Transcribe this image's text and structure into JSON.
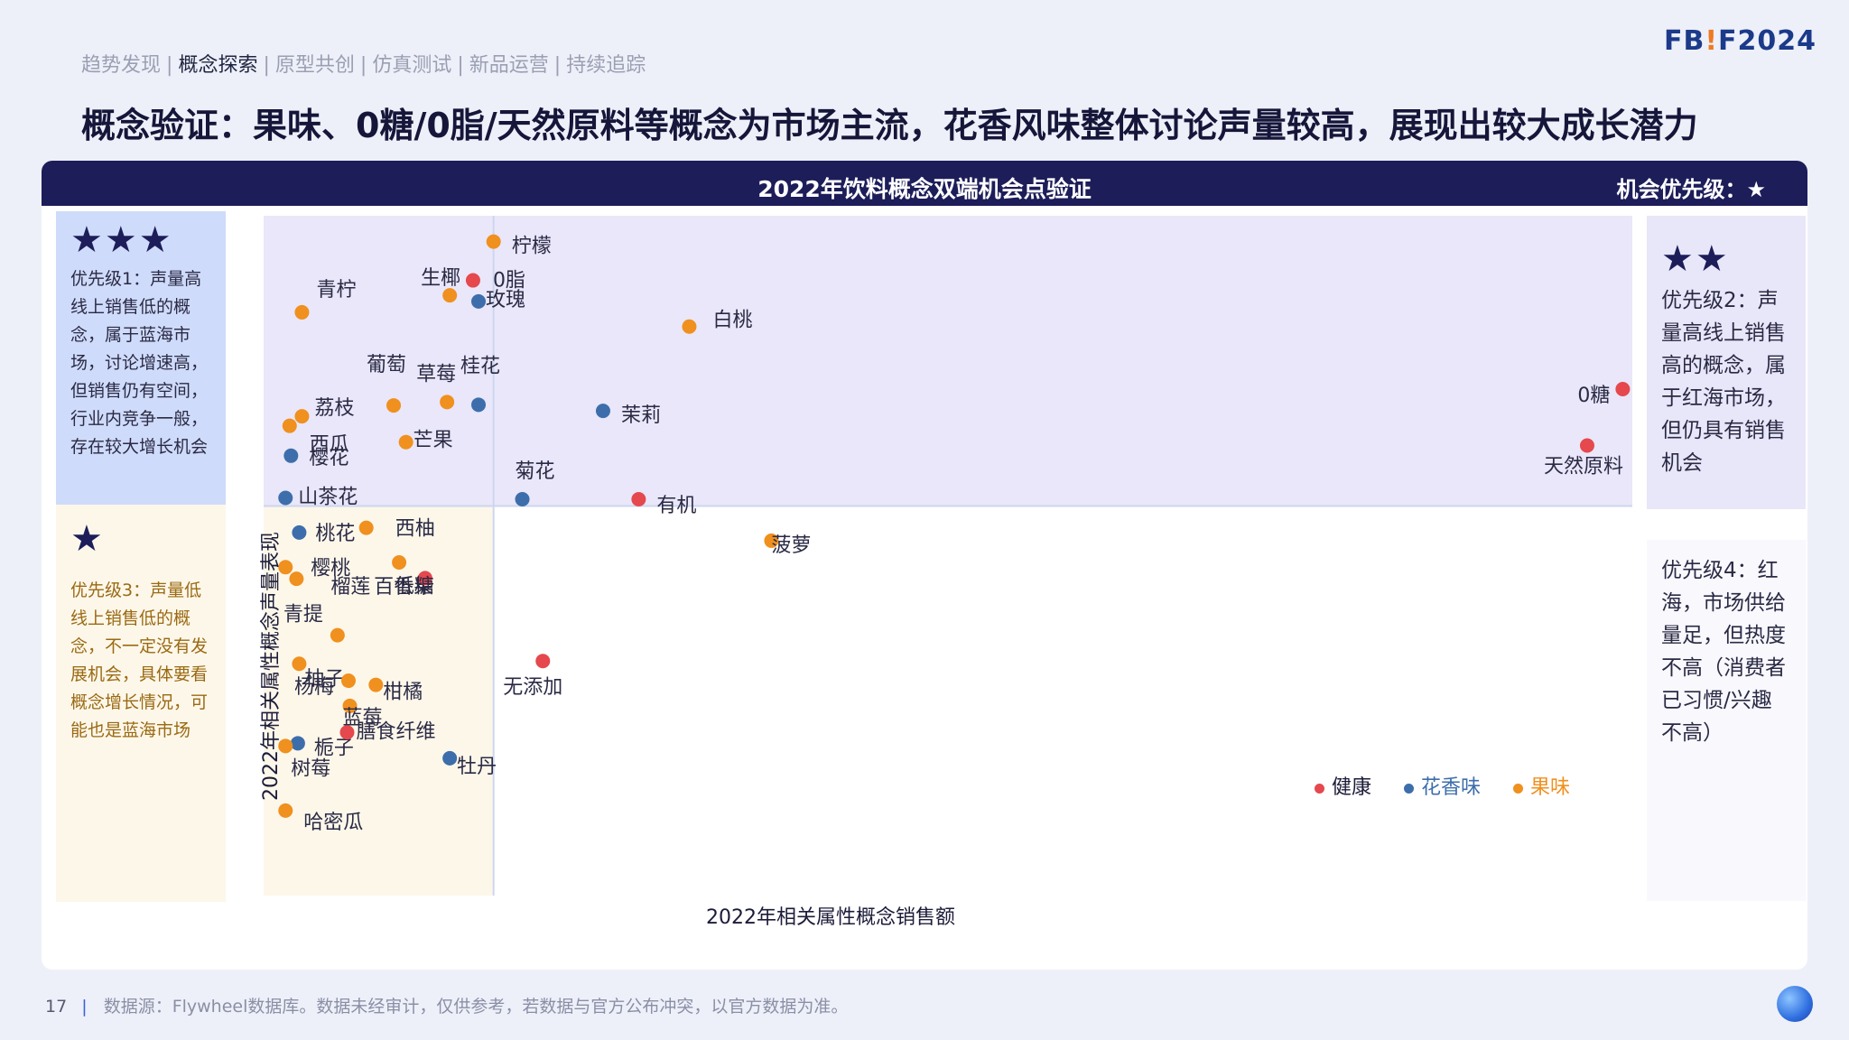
{
  "nav": {
    "items": [
      "趋势发现",
      "概念探索",
      "原型共创",
      "仿真测试",
      "新品运营",
      "持续追踪"
    ],
    "active_index": 1,
    "separator": "|"
  },
  "logo": {
    "left": "FB",
    "bang": "!",
    "right": "F2024"
  },
  "headline": "概念验证：果味、0糖/0脂/天然原料等概念为市场主流，花香风味整体讨论声量较高，展现出较大成长潜力",
  "card": {
    "title": "2022年饮料概念双端机会点验证",
    "priority_note": "机会优先级：★"
  },
  "boxes": {
    "p1": {
      "stars": "★★★",
      "text": "优先级1：声量高线上销售低的概念，属于蓝海市场，讨论增速高，但销售仍有空间，行业内竞争一般，存在较大增长机会"
    },
    "p2": {
      "stars": "★★",
      "text": "优先级2：声量高线上销售高的概念，属于红海市场，但仍具有销售机会"
    },
    "p3": {
      "stars": "★",
      "text": "优先级3：声量低线上销售低的概念，不一定没有发展机会，具体要看概念增长情况，可能也是蓝海市场"
    },
    "p4": {
      "stars": "",
      "text": "优先级4：红海，市场供给量足，但热度不高（消费者已习惯/兴趣不高）"
    }
  },
  "footer": {
    "page_number": "17",
    "source": "数据源：Flywheel数据库。数据未经审计，仅供参考，若数据与官方公布冲突，以官方数据为准。"
  },
  "colors": {
    "健康": "#e5484d",
    "花香味": "#3d6eab",
    "果味": "#f0901e",
    "header_bg": "#1d1d5a"
  },
  "chart_data": {
    "type": "scatter",
    "title": "2022年饮料概念双端机会点验证",
    "xlabel": "2022年相关属性概念销售额",
    "ylabel": "2022年相关属性概念声量表现",
    "note": "axes carry no numeric ticks; values are relative positions (0–100)",
    "xlim": [
      0,
      100
    ],
    "ylim": [
      0,
      100
    ],
    "quadrant_split": {
      "x": 16.8,
      "y": 57.3
    },
    "legend": {
      "position": "bottom-right",
      "entries": [
        "健康",
        "花香味",
        "果味"
      ]
    },
    "points": [
      {
        "label": "柠檬",
        "group": "果味",
        "x": 16.8,
        "y": 96.2
      },
      {
        "label": "生椰",
        "group": "果味",
        "x": 13.6,
        "y": 88.3
      },
      {
        "label": "0脂",
        "group": "健康",
        "x": 15.3,
        "y": 90.5
      },
      {
        "label": "玫瑰",
        "group": "花香味",
        "x": 15.7,
        "y": 87.4
      },
      {
        "label": "青柠",
        "group": "果味",
        "x": 2.8,
        "y": 85.8
      },
      {
        "label": "白桃",
        "group": "果味",
        "x": 31.1,
        "y": 83.7
      },
      {
        "label": "葡萄",
        "group": "果味",
        "x": 9.5,
        "y": 72.1
      },
      {
        "label": "草莓",
        "group": "果味",
        "x": 13.4,
        "y": 72.6
      },
      {
        "label": "桂花",
        "group": "花香味",
        "x": 15.7,
        "y": 72.2
      },
      {
        "label": "茉莉",
        "group": "花香味",
        "x": 24.8,
        "y": 71.3
      },
      {
        "label": "荔枝",
        "group": "果味",
        "x": 2.8,
        "y": 70.5
      },
      {
        "label": "西瓜",
        "group": "果味",
        "x": 1.9,
        "y": 69.1
      },
      {
        "label": "樱花",
        "group": "花香味",
        "x": 2.0,
        "y": 64.7
      },
      {
        "label": "芒果",
        "group": "果味",
        "x": 10.4,
        "y": 66.7
      },
      {
        "label": "山茶花",
        "group": "花香味",
        "x": 1.6,
        "y": 58.5
      },
      {
        "label": "菊花",
        "group": "花香味",
        "x": 18.9,
        "y": 58.3
      },
      {
        "label": "有机",
        "group": "健康",
        "x": 27.4,
        "y": 58.3
      },
      {
        "label": "0糖",
        "group": "健康",
        "x": 99.3,
        "y": 74.5
      },
      {
        "label": "天然原料",
        "group": "健康",
        "x": 96.7,
        "y": 66.2
      },
      {
        "label": "桃花",
        "group": "花香味",
        "x": 2.6,
        "y": 53.4
      },
      {
        "label": "西柚",
        "group": "果味",
        "x": 7.5,
        "y": 54.1
      },
      {
        "label": "百香果",
        "group": "果味",
        "x": 9.9,
        "y": 49.0
      },
      {
        "label": "菠萝",
        "group": "果味",
        "x": 37.1,
        "y": 52.2
      },
      {
        "label": "樱桃",
        "group": "果味",
        "x": 1.6,
        "y": 48.3
      },
      {
        "label": "榴莲",
        "group": "果味",
        "x": 2.4,
        "y": 46.6
      },
      {
        "label": "低糖",
        "group": "健康",
        "x": 11.8,
        "y": 46.7
      },
      {
        "label": "青提",
        "group": "果味",
        "x": 5.4,
        "y": 38.3
      },
      {
        "label": "柚子",
        "group": "果味",
        "x": 2.6,
        "y": 34.1
      },
      {
        "label": "无添加",
        "group": "健康",
        "x": 20.4,
        "y": 34.5
      },
      {
        "label": "杨梅",
        "group": "果味",
        "x": 6.2,
        "y": 31.6
      },
      {
        "label": "柑橘",
        "group": "果味",
        "x": 8.2,
        "y": 31.0
      },
      {
        "label": "蓝莓",
        "group": "果味",
        "x": 6.3,
        "y": 27.9
      },
      {
        "label": "栀子",
        "group": "花香味",
        "x": 2.5,
        "y": 22.4
      },
      {
        "label": "膳食纤维",
        "group": "健康",
        "x": 6.1,
        "y": 24.0
      },
      {
        "label": "牡丹",
        "group": "花香味",
        "x": 13.6,
        "y": 20.2
      },
      {
        "label": "树莓",
        "group": "果味",
        "x": 1.6,
        "y": 22.0
      },
      {
        "label": "哈密瓜",
        "group": "果味",
        "x": 1.6,
        "y": 12.5
      }
    ]
  }
}
